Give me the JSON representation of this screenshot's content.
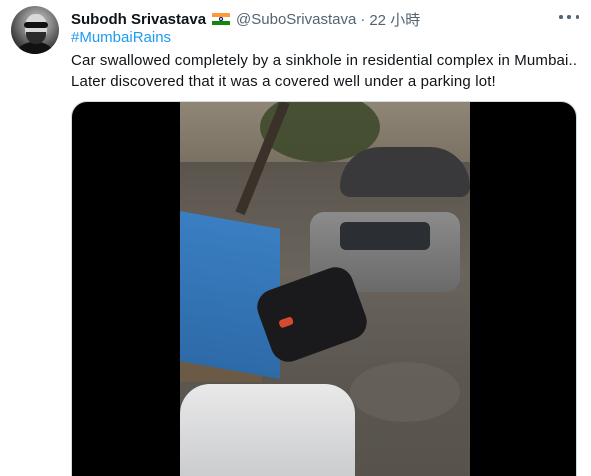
{
  "user": {
    "display_name": "Subodh Srivastava",
    "flag": "india-flag-icon",
    "handle": "@SuboSrivastava",
    "separator": "·",
    "time": "22 小時"
  },
  "tweet": {
    "hashtag": "#MumbaiRains",
    "text_line_1": "Car swallowed completely by a sinkhole in residential complex in Mumbai..",
    "text_line_2": "Later discovered that it was a covered well under a parking lot!"
  },
  "icons": {
    "more": "more-options-icon"
  },
  "colors": {
    "link": "#1d9bf0",
    "secondary_text": "#536471",
    "primary_text": "#0f1419"
  }
}
